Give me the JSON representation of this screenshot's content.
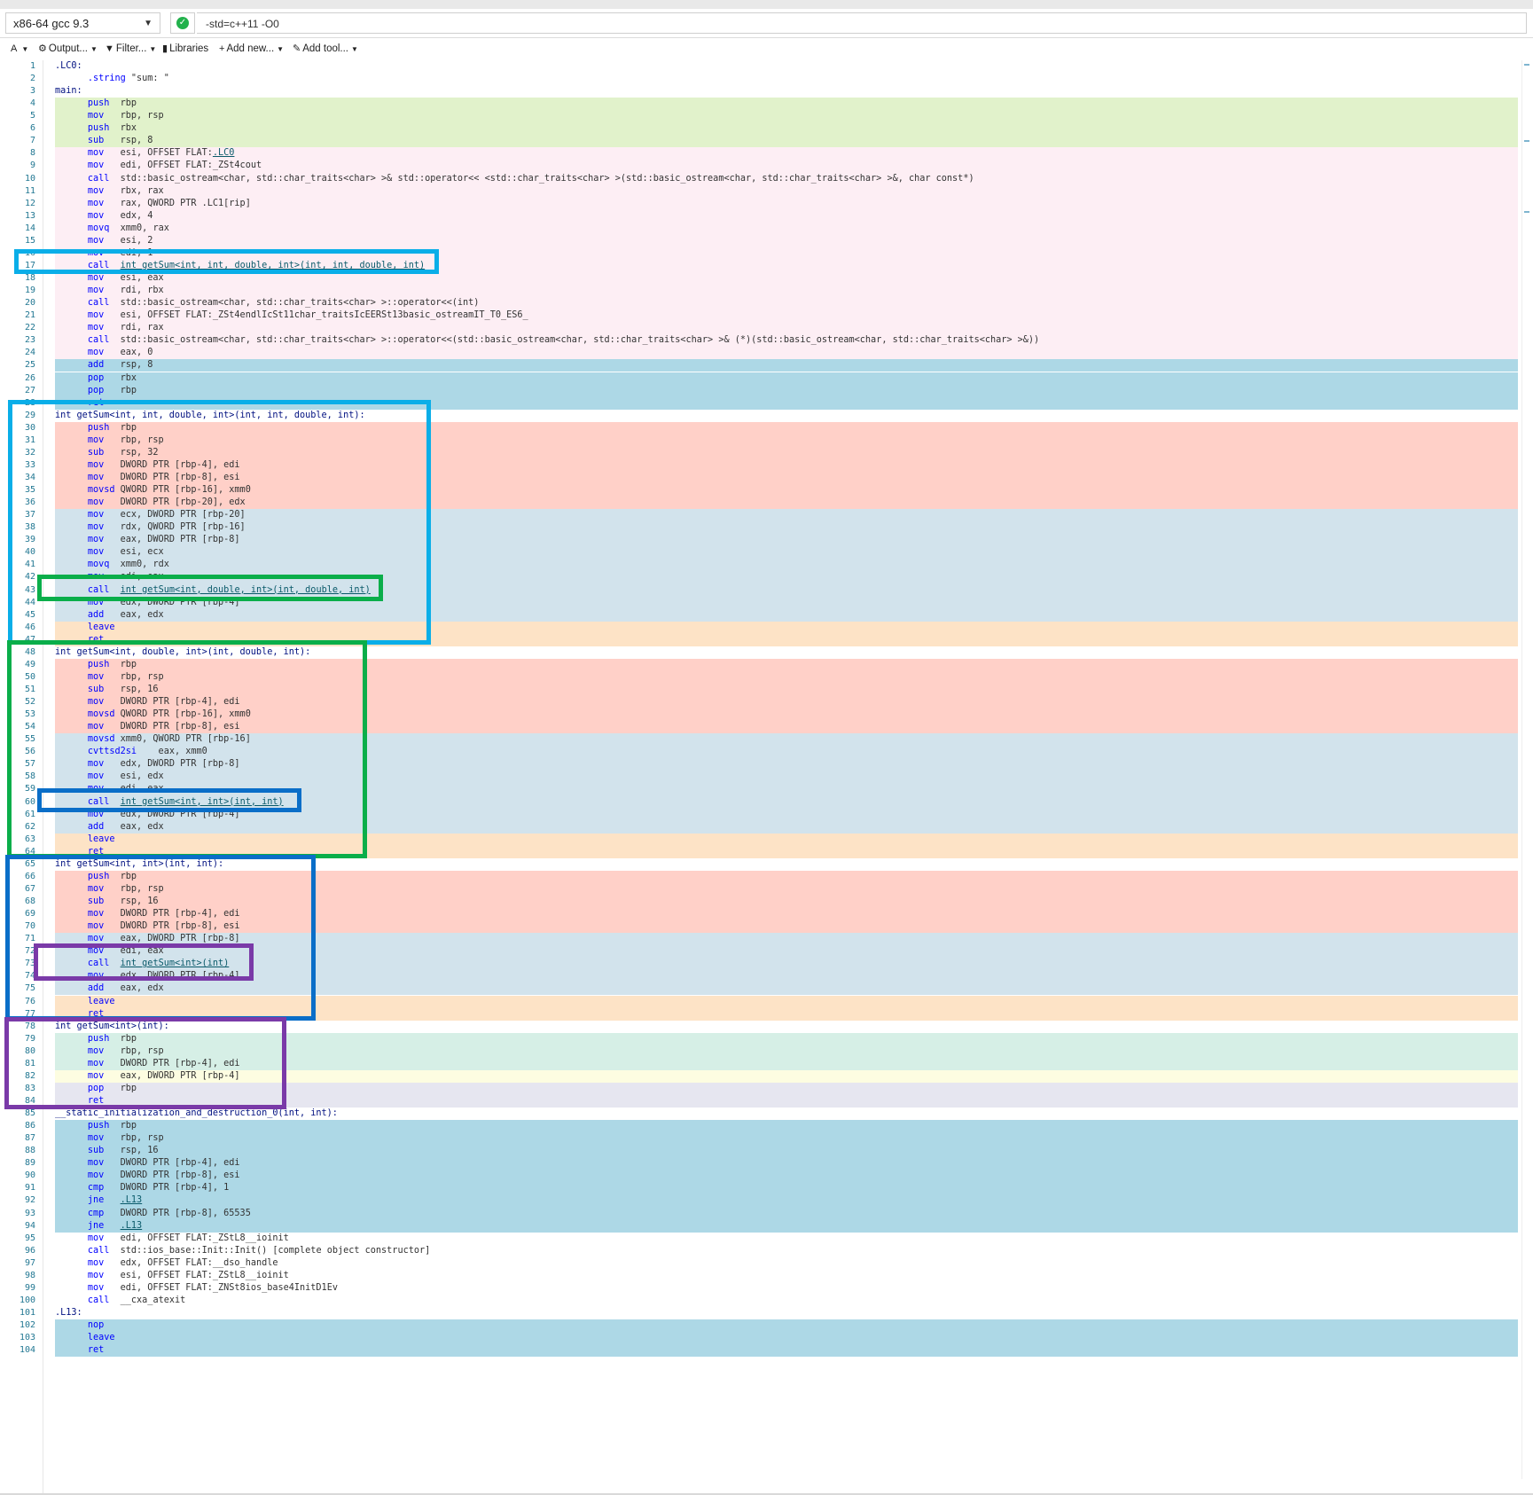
{
  "compiler": {
    "name": "x86-64 gcc 9.3",
    "flags": "-std=c++11 -O0",
    "status_icon": "check-circle-icon"
  },
  "toolbar": [
    {
      "label": "A",
      "icon": "font-icon",
      "dropdown": true
    },
    {
      "label": "Output...",
      "icon": "gear-icon",
      "dropdown": true
    },
    {
      "label": "Filter...",
      "icon": "filter-icon",
      "dropdown": true
    },
    {
      "label": "Libraries",
      "icon": "book-icon",
      "dropdown": false
    },
    {
      "label": "Add new...",
      "icon": "plus-icon",
      "dropdown": true
    },
    {
      "label": "Add tool...",
      "icon": "wrench-icon",
      "dropdown": true
    }
  ],
  "colors": {
    "green": "#e1f2cb",
    "pink": "#fdeef4",
    "blue": "#add8e6",
    "salmon": "#ffd0c8",
    "steel": "#d2e3ec",
    "peach": "#fde3c6",
    "mint": "#d6efe6",
    "yellow": "#fdfde1",
    "lavender": "#e6e6f0",
    "none": "#ffffff",
    "frame_light_blue": "#0aaee8",
    "frame_green": "#0aae4a",
    "frame_blue": "#0a6ec8",
    "frame_purple": "#7a3aa8"
  },
  "lines": [
    {
      "n": "1",
      "label": ".LC0:",
      "bg": "none"
    },
    {
      "n": "2",
      "op": ".string",
      "args": "\"sum: \"",
      "bg": "none"
    },
    {
      "n": "3",
      "label": "main:",
      "bg": "none"
    },
    {
      "n": "4",
      "op": "push",
      "args": "rbp",
      "bg": "green"
    },
    {
      "n": "5",
      "op": "mov",
      "args": "rbp, rsp",
      "bg": "green"
    },
    {
      "n": "6",
      "op": "push",
      "args": "rbx",
      "bg": "green"
    },
    {
      "n": "7",
      "op": "sub",
      "args": "rsp, 8",
      "bg": "green"
    },
    {
      "n": "8",
      "op": "mov",
      "args": "esi, OFFSET FLAT:",
      "link": ".LC0",
      "bg": "pink"
    },
    {
      "n": "9",
      "op": "mov",
      "args": "edi, OFFSET FLAT:_ZSt4cout",
      "bg": "pink"
    },
    {
      "n": "10",
      "op": "call",
      "args": "std::basic_ostream<char, std::char_traits<char> >& std::operator<< <std::char_traits<char> >(std::basic_ostream<char, std::char_traits<char> >&, char const*)",
      "bg": "pink"
    },
    {
      "n": "11",
      "op": "mov",
      "args": "rbx, rax",
      "bg": "pink"
    },
    {
      "n": "12",
      "op": "mov",
      "args": "rax, QWORD PTR .LC1[rip]",
      "bg": "pink"
    },
    {
      "n": "13",
      "op": "mov",
      "args": "edx, 4",
      "bg": "pink"
    },
    {
      "n": "14",
      "op": "movq",
      "args": "xmm0, rax",
      "bg": "pink"
    },
    {
      "n": "15",
      "op": "mov",
      "args": "esi, 2",
      "bg": "pink"
    },
    {
      "n": "16",
      "op": "mov",
      "args": "edi, 1",
      "bg": "pink"
    },
    {
      "n": "17",
      "op": "call",
      "args": "",
      "link": "int getSum<int, int, double, int>(int, int, double, int)",
      "bg": "pink"
    },
    {
      "n": "18",
      "op": "mov",
      "args": "esi, eax",
      "bg": "pink"
    },
    {
      "n": "19",
      "op": "mov",
      "args": "rdi, rbx",
      "bg": "pink"
    },
    {
      "n": "20",
      "op": "call",
      "args": "std::basic_ostream<char, std::char_traits<char> >::operator<<(int)",
      "bg": "pink"
    },
    {
      "n": "21",
      "op": "mov",
      "args": "esi, OFFSET FLAT:_ZSt4endlIcSt11char_traitsIcEERSt13basic_ostreamIT_T0_ES6_",
      "bg": "pink"
    },
    {
      "n": "22",
      "op": "mov",
      "args": "rdi, rax",
      "bg": "pink"
    },
    {
      "n": "23",
      "op": "call",
      "args": "std::basic_ostream<char, std::char_traits<char> >::operator<<(std::basic_ostream<char, std::char_traits<char> >& (*)(std::basic_ostream<char, std::char_traits<char> >&))",
      "bg": "pink"
    },
    {
      "n": "24",
      "op": "mov",
      "args": "eax, 0",
      "bg": "pink"
    },
    {
      "n": "25",
      "op": "add",
      "args": "rsp, 8",
      "bg": "blue"
    },
    {
      "n": "26",
      "op": "pop",
      "args": "rbx",
      "bg": "blue"
    },
    {
      "n": "27",
      "op": "pop",
      "args": "rbp",
      "bg": "blue"
    },
    {
      "n": "28",
      "op": "ret",
      "args": "",
      "bg": "blue"
    },
    {
      "n": "29",
      "label": "int getSum<int, int, double, int>(int, int, double, int):",
      "bg": "none"
    },
    {
      "n": "30",
      "op": "push",
      "args": "rbp",
      "bg": "salmon"
    },
    {
      "n": "31",
      "op": "mov",
      "args": "rbp, rsp",
      "bg": "salmon"
    },
    {
      "n": "32",
      "op": "sub",
      "args": "rsp, 32",
      "bg": "salmon"
    },
    {
      "n": "33",
      "op": "mov",
      "args": "DWORD PTR [rbp-4], edi",
      "bg": "salmon"
    },
    {
      "n": "34",
      "op": "mov",
      "args": "DWORD PTR [rbp-8], esi",
      "bg": "salmon"
    },
    {
      "n": "35",
      "op": "movsd",
      "args": "QWORD PTR [rbp-16], xmm0",
      "bg": "salmon"
    },
    {
      "n": "36",
      "op": "mov",
      "args": "DWORD PTR [rbp-20], edx",
      "bg": "salmon"
    },
    {
      "n": "37",
      "op": "mov",
      "args": "ecx, DWORD PTR [rbp-20]",
      "bg": "steel"
    },
    {
      "n": "38",
      "op": "mov",
      "args": "rdx, QWORD PTR [rbp-16]",
      "bg": "steel"
    },
    {
      "n": "39",
      "op": "mov",
      "args": "eax, DWORD PTR [rbp-8]",
      "bg": "steel"
    },
    {
      "n": "40",
      "op": "mov",
      "args": "esi, ecx",
      "bg": "steel"
    },
    {
      "n": "41",
      "op": "movq",
      "args": "xmm0, rdx",
      "bg": "steel"
    },
    {
      "n": "42",
      "op": "mov",
      "args": "edi, eax",
      "bg": "steel"
    },
    {
      "n": "43",
      "op": "call",
      "args": "",
      "link": "int getSum<int, double, int>(int, double, int)",
      "bg": "steel"
    },
    {
      "n": "44",
      "op": "mov",
      "args": "edx, DWORD PTR [rbp-4]",
      "bg": "steel"
    },
    {
      "n": "45",
      "op": "add",
      "args": "eax, edx",
      "bg": "steel"
    },
    {
      "n": "46",
      "op": "leave",
      "args": "",
      "bg": "peach"
    },
    {
      "n": "47",
      "op": "ret",
      "args": "",
      "bg": "peach"
    },
    {
      "n": "48",
      "label": "int getSum<int, double, int>(int, double, int):",
      "bg": "none"
    },
    {
      "n": "49",
      "op": "push",
      "args": "rbp",
      "bg": "salmon"
    },
    {
      "n": "50",
      "op": "mov",
      "args": "rbp, rsp",
      "bg": "salmon"
    },
    {
      "n": "51",
      "op": "sub",
      "args": "rsp, 16",
      "bg": "salmon"
    },
    {
      "n": "52",
      "op": "mov",
      "args": "DWORD PTR [rbp-4], edi",
      "bg": "salmon"
    },
    {
      "n": "53",
      "op": "movsd",
      "args": "QWORD PTR [rbp-16], xmm0",
      "bg": "salmon"
    },
    {
      "n": "54",
      "op": "mov",
      "args": "DWORD PTR [rbp-8], esi",
      "bg": "salmon"
    },
    {
      "n": "55",
      "op": "movsd",
      "args": "xmm0, QWORD PTR [rbp-16]",
      "bg": "steel"
    },
    {
      "n": "56",
      "op": "cvttsd2si",
      "args": "   eax, xmm0",
      "bg": "steel"
    },
    {
      "n": "57",
      "op": "mov",
      "args": "edx, DWORD PTR [rbp-8]",
      "bg": "steel"
    },
    {
      "n": "58",
      "op": "mov",
      "args": "esi, edx",
      "bg": "steel"
    },
    {
      "n": "59",
      "op": "mov",
      "args": "edi, eax",
      "bg": "steel"
    },
    {
      "n": "60",
      "op": "call",
      "args": "",
      "link": "int getSum<int, int>(int, int)",
      "bg": "steel"
    },
    {
      "n": "61",
      "op": "mov",
      "args": "edx, DWORD PTR [rbp-4]",
      "bg": "steel"
    },
    {
      "n": "62",
      "op": "add",
      "args": "eax, edx",
      "bg": "steel"
    },
    {
      "n": "63",
      "op": "leave",
      "args": "",
      "bg": "peach"
    },
    {
      "n": "64",
      "op": "ret",
      "args": "",
      "bg": "peach"
    },
    {
      "n": "65",
      "label": "int getSum<int, int>(int, int):",
      "bg": "none"
    },
    {
      "n": "66",
      "op": "push",
      "args": "rbp",
      "bg": "salmon"
    },
    {
      "n": "67",
      "op": "mov",
      "args": "rbp, rsp",
      "bg": "salmon"
    },
    {
      "n": "68",
      "op": "sub",
      "args": "rsp, 16",
      "bg": "salmon"
    },
    {
      "n": "69",
      "op": "mov",
      "args": "DWORD PTR [rbp-4], edi",
      "bg": "salmon"
    },
    {
      "n": "70",
      "op": "mov",
      "args": "DWORD PTR [rbp-8], esi",
      "bg": "salmon"
    },
    {
      "n": "71",
      "op": "mov",
      "args": "eax, DWORD PTR [rbp-8]",
      "bg": "steel"
    },
    {
      "n": "72",
      "op": "mov",
      "args": "edi, eax",
      "bg": "steel"
    },
    {
      "n": "73",
      "op": "call",
      "args": "",
      "link": "int getSum<int>(int)",
      "bg": "steel"
    },
    {
      "n": "74",
      "op": "mov",
      "args": "edx, DWORD PTR [rbp-4]",
      "bg": "steel"
    },
    {
      "n": "75",
      "op": "add",
      "args": "eax, edx",
      "bg": "steel"
    },
    {
      "n": "76",
      "op": "leave",
      "args": "",
      "bg": "peach"
    },
    {
      "n": "77",
      "op": "ret",
      "args": "",
      "bg": "peach"
    },
    {
      "n": "78",
      "label": "int getSum<int>(int):",
      "bg": "none"
    },
    {
      "n": "79",
      "op": "push",
      "args": "rbp",
      "bg": "mint"
    },
    {
      "n": "80",
      "op": "mov",
      "args": "rbp, rsp",
      "bg": "mint"
    },
    {
      "n": "81",
      "op": "mov",
      "args": "DWORD PTR [rbp-4], edi",
      "bg": "mint"
    },
    {
      "n": "82",
      "op": "mov",
      "args": "eax, DWORD PTR [rbp-4]",
      "bg": "yellow"
    },
    {
      "n": "83",
      "op": "pop",
      "args": "rbp",
      "bg": "lavender"
    },
    {
      "n": "84",
      "op": "ret",
      "args": "",
      "bg": "lavender"
    },
    {
      "n": "85",
      "label": "__static_initialization_and_destruction_0(int, int):",
      "bg": "none"
    },
    {
      "n": "86",
      "op": "push",
      "args": "rbp",
      "bg": "blue"
    },
    {
      "n": "87",
      "op": "mov",
      "args": "rbp, rsp",
      "bg": "blue"
    },
    {
      "n": "88",
      "op": "sub",
      "args": "rsp, 16",
      "bg": "blue"
    },
    {
      "n": "89",
      "op": "mov",
      "args": "DWORD PTR [rbp-4], edi",
      "bg": "blue"
    },
    {
      "n": "90",
      "op": "mov",
      "args": "DWORD PTR [rbp-8], esi",
      "bg": "blue"
    },
    {
      "n": "91",
      "op": "cmp",
      "args": "DWORD PTR [rbp-4], 1",
      "bg": "blue"
    },
    {
      "n": "92",
      "op": "jne",
      "args": "",
      "link": ".L13",
      "bg": "blue"
    },
    {
      "n": "93",
      "op": "cmp",
      "args": "DWORD PTR [rbp-8], 65535",
      "bg": "blue"
    },
    {
      "n": "94",
      "op": "jne",
      "args": "",
      "link": ".L13",
      "bg": "blue"
    },
    {
      "n": "95",
      "op": "mov",
      "args": "edi, OFFSET FLAT:_ZStL8__ioinit",
      "bg": "none"
    },
    {
      "n": "96",
      "op": "call",
      "args": "std::ios_base::Init::Init() [complete object constructor]",
      "bg": "none"
    },
    {
      "n": "97",
      "op": "mov",
      "args": "edx, OFFSET FLAT:__dso_handle",
      "bg": "none"
    },
    {
      "n": "98",
      "op": "mov",
      "args": "esi, OFFSET FLAT:_ZStL8__ioinit",
      "bg": "none"
    },
    {
      "n": "99",
      "op": "mov",
      "args": "edi, OFFSET FLAT:_ZNSt8ios_base4InitD1Ev",
      "bg": "none"
    },
    {
      "n": "100",
      "op": "call",
      "args": "__cxa_atexit",
      "bg": "none"
    },
    {
      "n": "101",
      "label": ".L13:",
      "bg": "none"
    },
    {
      "n": "102",
      "op": "nop",
      "args": "",
      "bg": "blue"
    },
    {
      "n": "103",
      "op": "leave",
      "args": "",
      "bg": "blue"
    },
    {
      "n": "104",
      "op": "ret",
      "args": "",
      "bg": "blue"
    }
  ]
}
